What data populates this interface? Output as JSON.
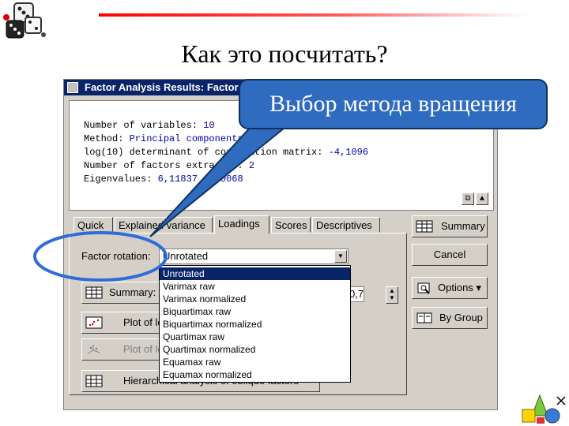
{
  "slide": {
    "title": "Как это посчитать?"
  },
  "callout": {
    "text": "Выбор метода вращения"
  },
  "window": {
    "title": "Factor Analysis Results: Factor Analysis 1"
  },
  "results": {
    "lines": [
      {
        "label": "Number of variables: ",
        "value": "10"
      },
      {
        "label": "Method: ",
        "value": "Principal components"
      },
      {
        "label": "log(10) determinant of correlation matrix: ",
        "value": "-4,1096"
      },
      {
        "label": "Number of factors extracted: ",
        "value": "2"
      },
      {
        "label": "Eigenvalues: ",
        "value": "6,11837  1,80068"
      }
    ]
  },
  "tabs": [
    "Quick",
    "Explained variance",
    "Loadings",
    "Scores",
    "Descriptives"
  ],
  "active_tab": "Loadings",
  "loadings": {
    "rotation_label": "Factor rotation:",
    "rotation_value": "Unrotated",
    "summary_label": "Summary: Factor loadings",
    "plot1_label": "Plot of loadings, 2D",
    "plot2_label": "Plot of loadings, 3D",
    "hier_label": "Hierarchical analysis of oblique factors",
    "spin_value": "0,70"
  },
  "side_buttons": {
    "summary": "Summary",
    "cancel": "Cancel",
    "options": "Options",
    "bygroup": "By Group"
  },
  "rotation_options": [
    "Unrotated",
    "Varimax raw",
    "Varimax normalized",
    "Biquartimax raw",
    "Biquartimax normalized",
    "Quartimax raw",
    "Quartimax normalized",
    "Equamax raw",
    "Equamax normalized"
  ],
  "colors": {
    "callout": "#2f6bbf",
    "oval": "#2f6bd9",
    "title_bar": "#0a246a",
    "accent_line": "#ff0000"
  }
}
